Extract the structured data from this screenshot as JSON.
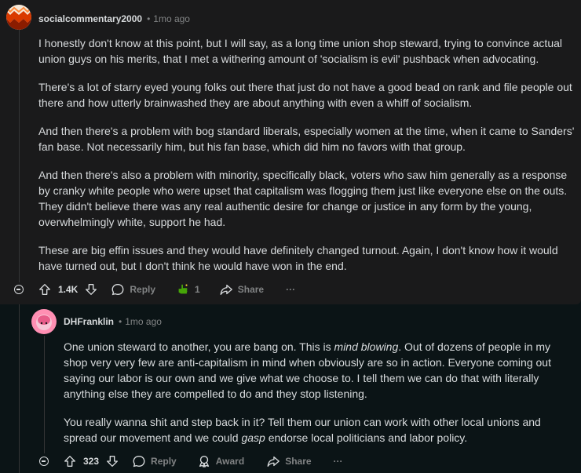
{
  "comments": [
    {
      "username": "socialcommentary2000",
      "separator": "•",
      "time": "1mo ago",
      "paragraphs": [
        "I honestly don't know at this point, but I will say, as a long time union shop steward, trying to convince actual union guys on his merits, that I met a withering amount of 'socialism is evil' pushback when advocating.",
        "There's a lot of starry eyed young folks out there that just do not have a good bead on rank and file people out there and how utterly brainwashed they are about anything with even a whiff of socialism.",
        "And then there's a problem with bog standard liberals, especially women at the time, when it came to Sanders' fan base. Not necessarily him, but his fan base, which did him no favors with that group.",
        "And then there's also a problem with minority, specifically black, voters who saw him generally as a response by cranky white people who were upset that capitalism was flogging them just like everyone else on the outs. They didn't believe there was any real authentic desire for change or justice in any form by the young, overwhelmingly white, support he had.",
        "These are big effin issues and they would have definitely changed turnout. Again, I don't know how it would have turned out, but I don't think he would have won in the end."
      ],
      "score": "1.4K",
      "award_count": "1",
      "reply_label": "Reply",
      "share_label": "Share",
      "more_label": "···"
    },
    {
      "username": "DHFranklin",
      "separator": "•",
      "time": "1mo ago",
      "p1_a": "One union steward to another, you are bang on. This is ",
      "p1_em": "mind blowing",
      "p1_b": ". Out of dozens of people in my shop very very few are anti-capitalism in mind when obviously are so in action. Everyone coming out saying our labor is our own and we give what we choose to. I tell them we can do that with literally anything else they are compelled to do and they stop listening.",
      "p2_a": "You really wanna shit and step back in it? Tell them our union can work with other local unions and spread our movement and we could ",
      "p2_em": "gasp",
      "p2_b": " endorse local politicians and labor policy.",
      "score": "323",
      "reply_label": "Reply",
      "award_label": "Award",
      "share_label": "Share",
      "more_label": "···"
    }
  ],
  "colors": {
    "background": "#0b1416",
    "card": "#1a1a1b",
    "text": "#d7dadc",
    "muted": "#818384"
  }
}
